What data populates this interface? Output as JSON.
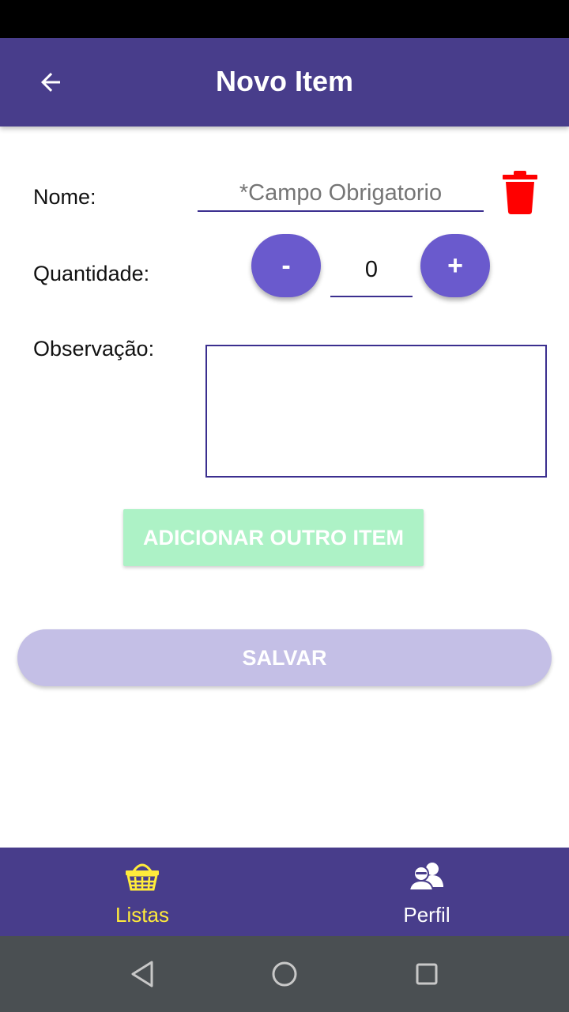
{
  "app_bar": {
    "title": "Novo Item"
  },
  "form": {
    "name_label": "Nome:",
    "name_placeholder": "*Campo Obrigatorio",
    "quantity_label": "Quantidade:",
    "decrement_label": "-",
    "increment_label": "+",
    "quantity_value": "0",
    "observation_label": "Observação:",
    "observation_value": ""
  },
  "buttons": {
    "add_another": "ADICIONAR OUTRO ITEM",
    "save": "SALVAR"
  },
  "bottom_nav": [
    {
      "label": "Listas",
      "icon": "basket-icon",
      "active": true
    },
    {
      "label": "Perfil",
      "icon": "users-icon",
      "active": false
    }
  ],
  "colors": {
    "primary": "#483d8b",
    "accent": "#6a5acd",
    "active_nav": "#ffeb3b",
    "delete": "#ff0000",
    "add_button": "#adf2c6",
    "save_button": "#c4bfe6"
  }
}
